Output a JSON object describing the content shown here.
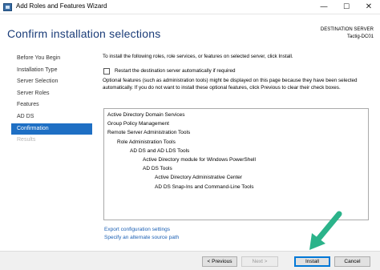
{
  "window": {
    "title": "Add Roles and Features Wizard",
    "minimize_glyph": "—",
    "maximize_glyph": "☐",
    "close_glyph": "✕"
  },
  "header": {
    "title": "Confirm installation selections",
    "destination_label": "DESTINATION SERVER",
    "destination_value": "Tactig-DC01"
  },
  "nav": {
    "items": [
      {
        "label": "Before You Begin",
        "state": "normal"
      },
      {
        "label": "Installation Type",
        "state": "normal"
      },
      {
        "label": "Server Selection",
        "state": "normal"
      },
      {
        "label": "Server Roles",
        "state": "normal"
      },
      {
        "label": "Features",
        "state": "normal"
      },
      {
        "label": "AD DS",
        "state": "normal"
      },
      {
        "label": "Confirmation",
        "state": "active"
      },
      {
        "label": "Results",
        "state": "disabled"
      }
    ]
  },
  "content": {
    "intro": "To install the following roles, role services, or features on selected server, click Install.",
    "restart_label": "Restart the destination server automatically if required",
    "restart_checked": false,
    "optional_note": "Optional features (such as administration tools) might be displayed on this page because they have been selected automatically. If you do not want to install these optional features, click Previous to clear their check boxes."
  },
  "features": [
    {
      "label": "Active Directory Domain Services",
      "level": 0
    },
    {
      "label": "Group Policy Management",
      "level": 0
    },
    {
      "label": "Remote Server Administration Tools",
      "level": 0
    },
    {
      "label": "Role Administration Tools",
      "level": 1
    },
    {
      "label": "AD DS and AD LDS Tools",
      "level": 2
    },
    {
      "label": "Active Directory module for Windows PowerShell",
      "level": 3
    },
    {
      "label": "AD DS Tools",
      "level": 3
    },
    {
      "label": "Active Directory Administrative Center",
      "level": 4
    },
    {
      "label": "AD DS Snap-Ins and Command-Line Tools",
      "level": 4
    }
  ],
  "links": {
    "export": "Export configuration settings",
    "alternate_source": "Specify an alternate source path"
  },
  "footer": {
    "previous": "< Previous",
    "next": "Next >",
    "install": "Install",
    "cancel": "Cancel"
  },
  "colors": {
    "accent": "#1e6fc4",
    "title_text": "#1a3c78",
    "link": "#1a5fb4",
    "arrow": "#2bb38a"
  }
}
